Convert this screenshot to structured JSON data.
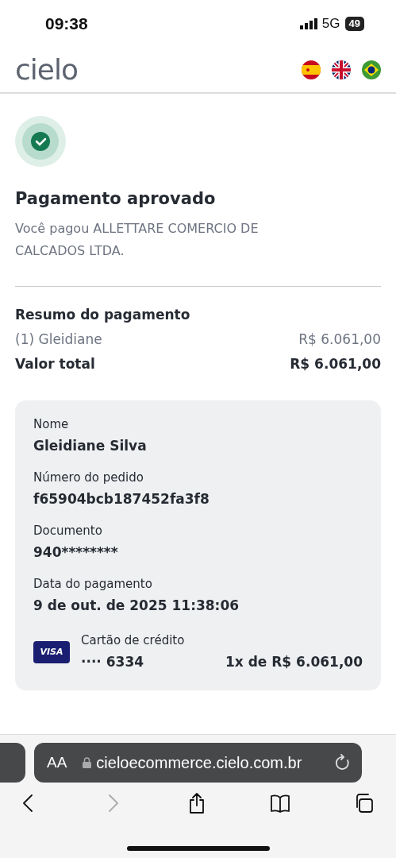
{
  "status_bar": {
    "time": "09:38",
    "network": "5G",
    "battery": "49"
  },
  "header": {
    "logo": "cielo",
    "languages": [
      {
        "kind": "es"
      },
      {
        "kind": "uk"
      },
      {
        "kind": "br"
      }
    ]
  },
  "result": {
    "title": "Pagamento aprovado",
    "message": "Você pagou ALLETTARE COMERCIO DE CALCADOS LTDA."
  },
  "summary": {
    "title": "Resumo do pagamento",
    "items": [
      {
        "label": "(1) Gleidiane",
        "amount": "R$ 6.061,00"
      }
    ],
    "total_label": "Valor total",
    "total_amount": "R$ 6.061,00"
  },
  "details": {
    "fields": [
      {
        "label": "Nome",
        "value": "Gleidiane Silva"
      },
      {
        "label": "Número do pedido",
        "value": "f65904bcb187452fa3f8"
      },
      {
        "label": "Documento",
        "value": "940********"
      },
      {
        "label": "Data do pagamento",
        "value": "9 de out. de 2025 11:38:06"
      }
    ],
    "card": {
      "brand": "VISA",
      "type": "Cartão de crédito",
      "number": "···· 6334",
      "installments": "1x de R$ 6.061,00"
    }
  },
  "browser": {
    "text_size": "AA",
    "url": "cieloecommerce.cielo.com.br",
    "nav": [
      {
        "kind": "back",
        "disabled": false
      },
      {
        "kind": "forward",
        "disabled": true
      },
      {
        "kind": "share",
        "disabled": false
      },
      {
        "kind": "bookmarks",
        "disabled": false
      },
      {
        "kind": "tabs",
        "disabled": false
      }
    ]
  }
}
